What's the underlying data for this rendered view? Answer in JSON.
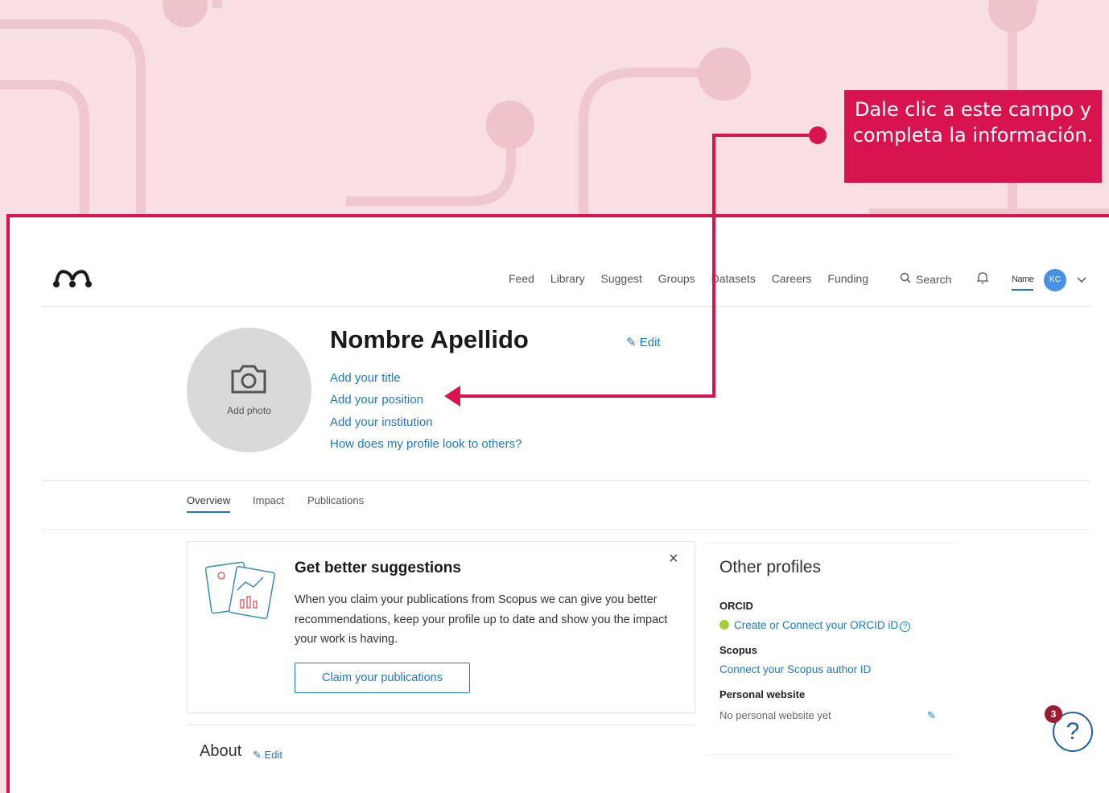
{
  "callout": {
    "text": "Dale clic a este campo y completa la información."
  },
  "nav": {
    "links": [
      "Feed",
      "Library",
      "Suggest",
      "Groups",
      "Datasets",
      "Careers",
      "Funding"
    ],
    "search_label": "Search",
    "username": "Name",
    "avatar_initials": "KC"
  },
  "profile": {
    "name": "Nombre Apellido",
    "edit_label": "Edit",
    "add_photo": "Add photo",
    "links": [
      "Add your title",
      "Add your position",
      "Add your institution",
      "How does my profile look to others?"
    ]
  },
  "tabs": [
    "Overview",
    "Impact",
    "Publications"
  ],
  "suggestions_card": {
    "title": "Get better suggestions",
    "body": "When you claim your publications from Scopus we can give you better recommendations, keep your profile up to date and show you the impact your work is having.",
    "button": "Claim your publications",
    "close": "×"
  },
  "about": {
    "title": "About",
    "edit_label": "Edit"
  },
  "other_profiles": {
    "title": "Other profiles",
    "orcid_label": "ORCID",
    "orcid_link": "Create or Connect your ORCID iD",
    "scopus_label": "Scopus",
    "scopus_link": "Connect your Scopus author ID",
    "website_label": "Personal website",
    "website_value": "No personal website yet"
  },
  "help": {
    "badge_count": "3",
    "glyph": "?"
  },
  "colors": {
    "accent": "#d8144f",
    "link": "#1e78c8",
    "background": "#f7dfe2"
  }
}
